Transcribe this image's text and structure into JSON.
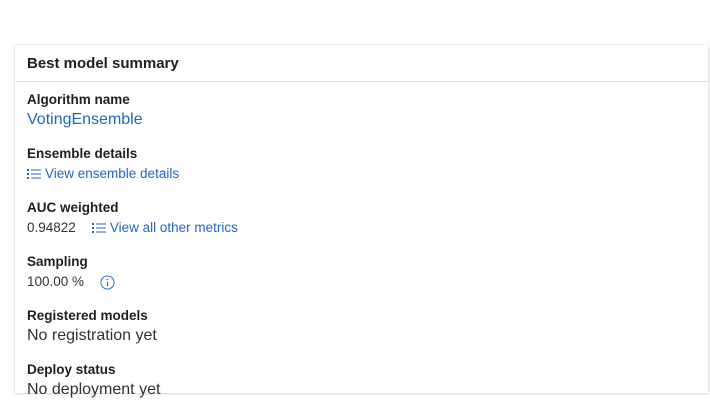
{
  "card": {
    "title": "Best model summary"
  },
  "algorithm": {
    "label": "Algorithm name",
    "value": "VotingEnsemble"
  },
  "ensemble": {
    "label": "Ensemble details",
    "link": "View ensemble details"
  },
  "auc": {
    "label": "AUC weighted",
    "value": "0.94822",
    "link": "View all other metrics"
  },
  "sampling": {
    "label": "Sampling",
    "value": "100.00 %"
  },
  "registered": {
    "label": "Registered models",
    "value": "No registration yet"
  },
  "deploy": {
    "label": "Deploy status",
    "value": "No deployment yet"
  },
  "colors": {
    "link": "#2266c2",
    "text": "#323130",
    "divider": "#e1dfdd"
  },
  "icons": {
    "list": "bulleted-list-icon",
    "info": "info-icon"
  }
}
